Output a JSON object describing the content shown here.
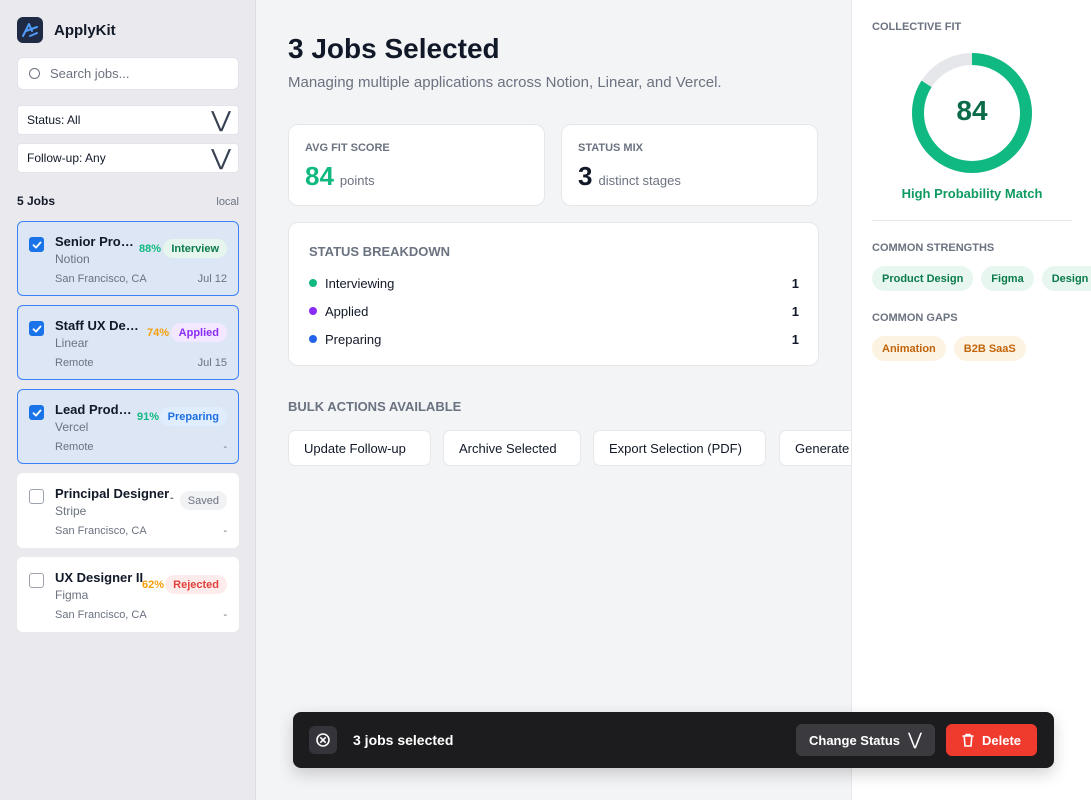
{
  "app": {
    "name": "ApplyKit"
  },
  "sidebar": {
    "search_placeholder": "Search jobs...",
    "filters": {
      "status": "Status: All",
      "followup": "Follow-up: Any"
    },
    "list_count": "5 Jobs",
    "list_scope": "local",
    "jobs": [
      {
        "title": "Senior Product Designer",
        "company": "Notion",
        "location": "San Francisco, CA",
        "date": "Jul 12",
        "fit": "88%",
        "status": "Interview",
        "selected": true
      },
      {
        "title": "Staff UX Designer",
        "company": "Linear",
        "location": "Remote",
        "date": "Jul 15",
        "fit": "74%",
        "status": "Applied",
        "selected": true
      },
      {
        "title": "Lead Product Designer",
        "company": "Vercel",
        "location": "Remote",
        "date": "-",
        "fit": "91%",
        "status": "Preparing",
        "selected": true
      },
      {
        "title": "Principal Designer",
        "company": "Stripe",
        "location": "San Francisco, CA",
        "date": "-",
        "fit": "-",
        "status": "Saved",
        "selected": false
      },
      {
        "title": "UX Designer II",
        "company": "Figma",
        "location": "San Francisco, CA",
        "date": "-",
        "fit": "62%",
        "status": "Rejected",
        "selected": false
      }
    ]
  },
  "main": {
    "title": "3 Jobs Selected",
    "subtitle": "Managing multiple applications across Notion, Linear, and Vercel.",
    "stats": {
      "avg": {
        "label": "AVG FIT SCORE",
        "value": "84",
        "unit": "points"
      },
      "mix": {
        "label": "STATUS MIX",
        "value": "3",
        "unit": "distinct stages"
      }
    },
    "breakdown": {
      "heading": "STATUS BREAKDOWN",
      "rows": [
        {
          "name": "Interviewing",
          "count": "1",
          "color": "#10b981"
        },
        {
          "name": "Applied",
          "count": "1",
          "color": "#8b2cf5"
        },
        {
          "name": "Preparing",
          "count": "1",
          "color": "#2563eb"
        }
      ]
    },
    "bulk": {
      "heading": "BULK ACTIONS AVAILABLE",
      "actions": [
        "Update Follow-up",
        "Archive Selected",
        "Export Selection (PDF)",
        "Generate"
      ]
    }
  },
  "right": {
    "fit_label": "COLLECTIVE FIT",
    "fit_score": "84",
    "fit_score_fraction": 0.84,
    "fit_caption": "High Probability Match",
    "strengths_label": "COMMON STRENGTHS",
    "strengths": [
      "Product Design",
      "Figma",
      "Design Systems"
    ],
    "gaps_label": "COMMON GAPS",
    "gaps": [
      "Animation",
      "B2B SaaS"
    ]
  },
  "bottom_bar": {
    "count": "3 jobs selected",
    "change_status": "Change Status",
    "delete": "Delete"
  },
  "colors": {
    "accent": "#1a73e8",
    "success": "#10b981",
    "warning": "#f59e0b",
    "danger": "#ef3b2d"
  }
}
